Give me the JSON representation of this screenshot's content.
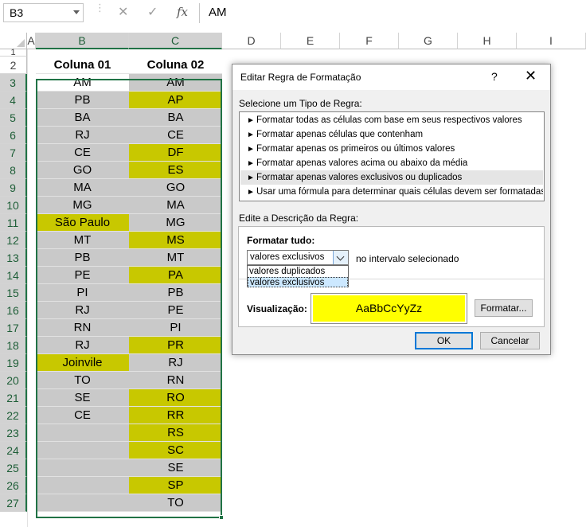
{
  "formula_bar": {
    "name_box": "B3",
    "content": "AM",
    "cancel_glyph": "✕",
    "enter_glyph": "✓",
    "fx_label": "fx"
  },
  "sheet": {
    "columns": [
      "A",
      "B",
      "C",
      "D",
      "E",
      "F",
      "G",
      "H",
      "I"
    ],
    "rows": [
      "1",
      "2",
      "3",
      "4",
      "5",
      "6",
      "7",
      "8",
      "9",
      "10",
      "11",
      "12",
      "13",
      "14",
      "15",
      "16",
      "17",
      "18",
      "19",
      "20",
      "21",
      "22",
      "23",
      "24",
      "25",
      "26",
      "27"
    ],
    "header_b": "Coluna 01",
    "header_c": "Coluna 02",
    "col_b": [
      "AM",
      "PB",
      "BA",
      "RJ",
      "CE",
      "GO",
      "MA",
      "MG",
      "São Paulo",
      "MT",
      "PB",
      "PE",
      "PI",
      "RJ",
      "RN",
      "RJ",
      "Joinvile",
      "TO",
      "SE",
      "CE",
      "",
      "",
      "",
      "",
      "",
      ""
    ],
    "col_c": [
      "AM",
      "AP",
      "BA",
      "CE",
      "DF",
      "ES",
      "GO",
      "MA",
      "MG",
      "MS",
      "MT",
      "PA",
      "PB",
      "PE",
      "PI",
      "PR",
      "RJ",
      "RN",
      "RO",
      "RR",
      "RS",
      "SC",
      "SE",
      "SP",
      "TO"
    ],
    "col_b_fill": [
      "white",
      "gray",
      "gray",
      "gray",
      "gray",
      "gray",
      "gray",
      "gray",
      "yellow",
      "gray",
      "gray",
      "gray",
      "gray",
      "gray",
      "gray",
      "gray",
      "yellow",
      "gray",
      "gray",
      "gray",
      "gray",
      "gray",
      "gray",
      "gray",
      "gray"
    ],
    "col_c_fill": [
      "gray",
      "yellow",
      "gray",
      "gray",
      "yellow",
      "yellow",
      "gray",
      "gray",
      "gray",
      "yellow",
      "gray",
      "yellow",
      "gray",
      "gray",
      "gray",
      "yellow",
      "gray",
      "gray",
      "yellow",
      "yellow",
      "yellow",
      "yellow",
      "gray",
      "yellow",
      "gray"
    ],
    "colors": {
      "gray": "#c9c9c9",
      "yellow": "#c8c800",
      "selection": "#217346"
    }
  },
  "dialog": {
    "title": "Editar Regra de Formatação",
    "help": "?",
    "close": "✕",
    "rule_type_label": "Selecione um Tipo de Regra:",
    "rule_types": [
      "Formatar todas as células com base em seus respectivos valores",
      "Formatar apenas células que contenham",
      "Formatar apenas os primeiros ou últimos valores",
      "Formatar apenas valores acima ou abaixo da média",
      "Formatar apenas valores exclusivos ou duplicados",
      "Usar uma fórmula para determinar quais células devem ser formatadas"
    ],
    "rule_arrow": "►",
    "description_label": "Edite a Descrição da Regra:",
    "format_all_label": "Formatar tudo:",
    "combo_value": "valores exclusivos",
    "in_range_label": "no intervalo selecionado",
    "dropdown_options": [
      "valores duplicados",
      "valores exclusivos"
    ],
    "preview_label": "Visualização:",
    "preview_text": "AaBbCcYyZz",
    "preview_color": "#ffff00",
    "format_button": "Formatar...",
    "ok_button": "OK",
    "cancel_button": "Cancelar"
  }
}
